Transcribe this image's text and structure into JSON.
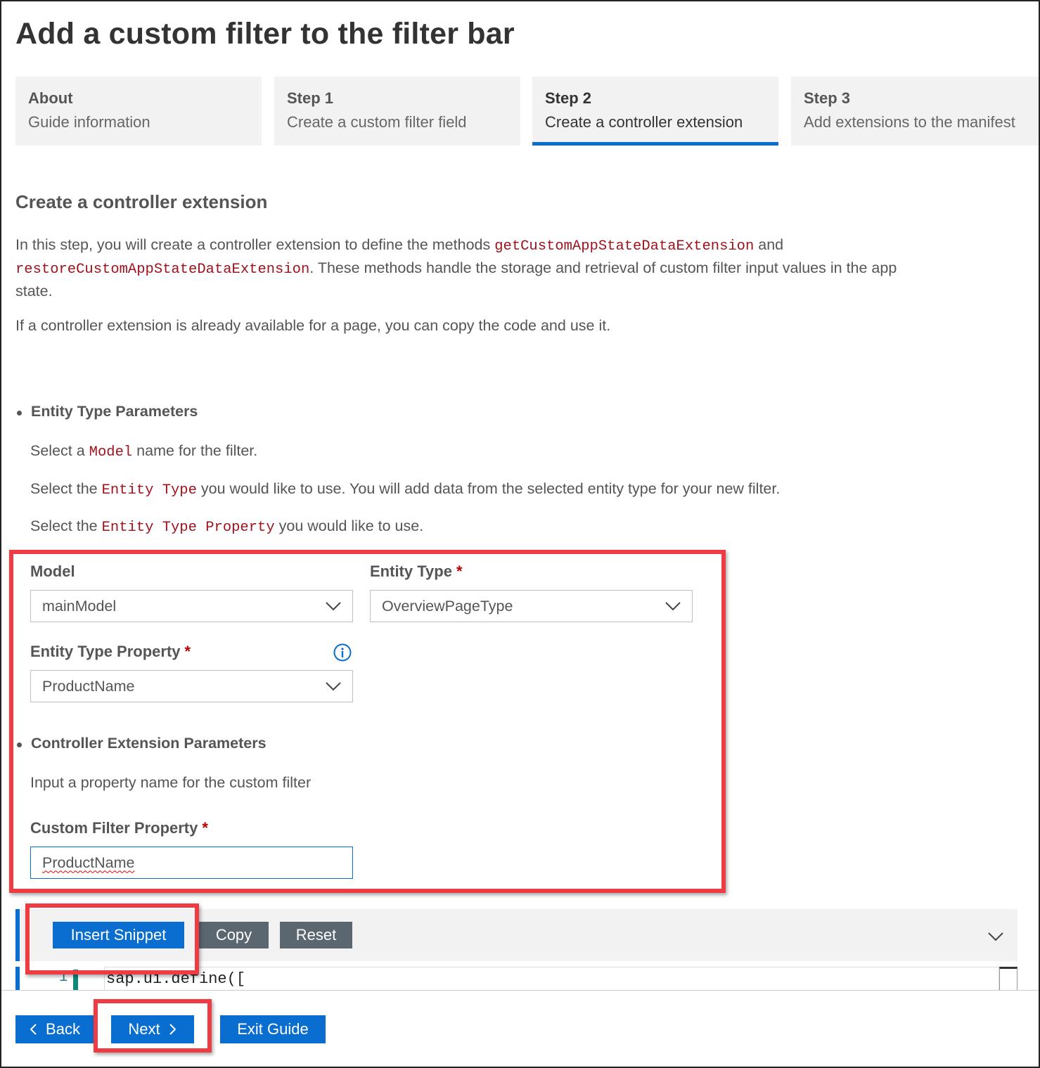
{
  "page": {
    "title": "Add a custom filter to the filter bar"
  },
  "tabs": [
    {
      "title": "About",
      "subtitle": "Guide information",
      "active": false
    },
    {
      "title": "Step 1",
      "subtitle": "Create a custom filter field",
      "active": false
    },
    {
      "title": "Step 2",
      "subtitle": "Create a controller extension",
      "active": true
    },
    {
      "title": "Step 3",
      "subtitle": "Add extensions to the manifest",
      "active": false
    }
  ],
  "content": {
    "section_title": "Create a controller extension",
    "intro": {
      "part1": "In this step, you will create a controller extension to define the methods ",
      "code1": "getCustomAppStateDataExtension",
      "part2": " and",
      "code2": "restoreCustomAppStateDataExtension",
      "part3": ". These methods handle the storage and retrieval of custom filter input values in the app",
      "part4": "state."
    },
    "note": "If a controller extension is already available for a page, you can copy the code and use it.",
    "entity_section": {
      "heading": "Entity Type Parameters",
      "line1": {
        "pre": "Select a ",
        "code": "Model",
        "post": " name for the filter."
      },
      "line2": {
        "pre": "Select the ",
        "code": "Entity Type",
        "post": " you would like to use. You will add data from the selected entity type for your new filter."
      },
      "line3": {
        "pre": "Select the ",
        "code": "Entity Type Property",
        "post": " you would like to use."
      }
    },
    "form": {
      "model": {
        "label": "Model",
        "value": "mainModel"
      },
      "entity_type": {
        "label": "Entity Type",
        "required_mark": "*",
        "value": "OverviewPageType"
      },
      "entity_type_property": {
        "label": "Entity Type Property",
        "required_mark": "*",
        "value": "ProductName"
      }
    },
    "controller_section": {
      "heading": "Controller Extension Parameters",
      "description": "Input a property name for the custom filter",
      "custom_filter_property": {
        "label": "Custom Filter Property",
        "required_mark": "*",
        "value": "ProductName"
      }
    }
  },
  "toolbar": {
    "insert_snippet": "Insert Snippet",
    "copy": "Copy",
    "reset": "Reset"
  },
  "editor": {
    "line_number": "1",
    "code": "sap.ui.define(["
  },
  "footer": {
    "back": "Back",
    "next": "Next",
    "exit": "Exit Guide"
  },
  "colors": {
    "accent": "#0a6ed1",
    "highlight": "#ef3b44",
    "required": "#bb0000",
    "code": "#a1121c"
  }
}
